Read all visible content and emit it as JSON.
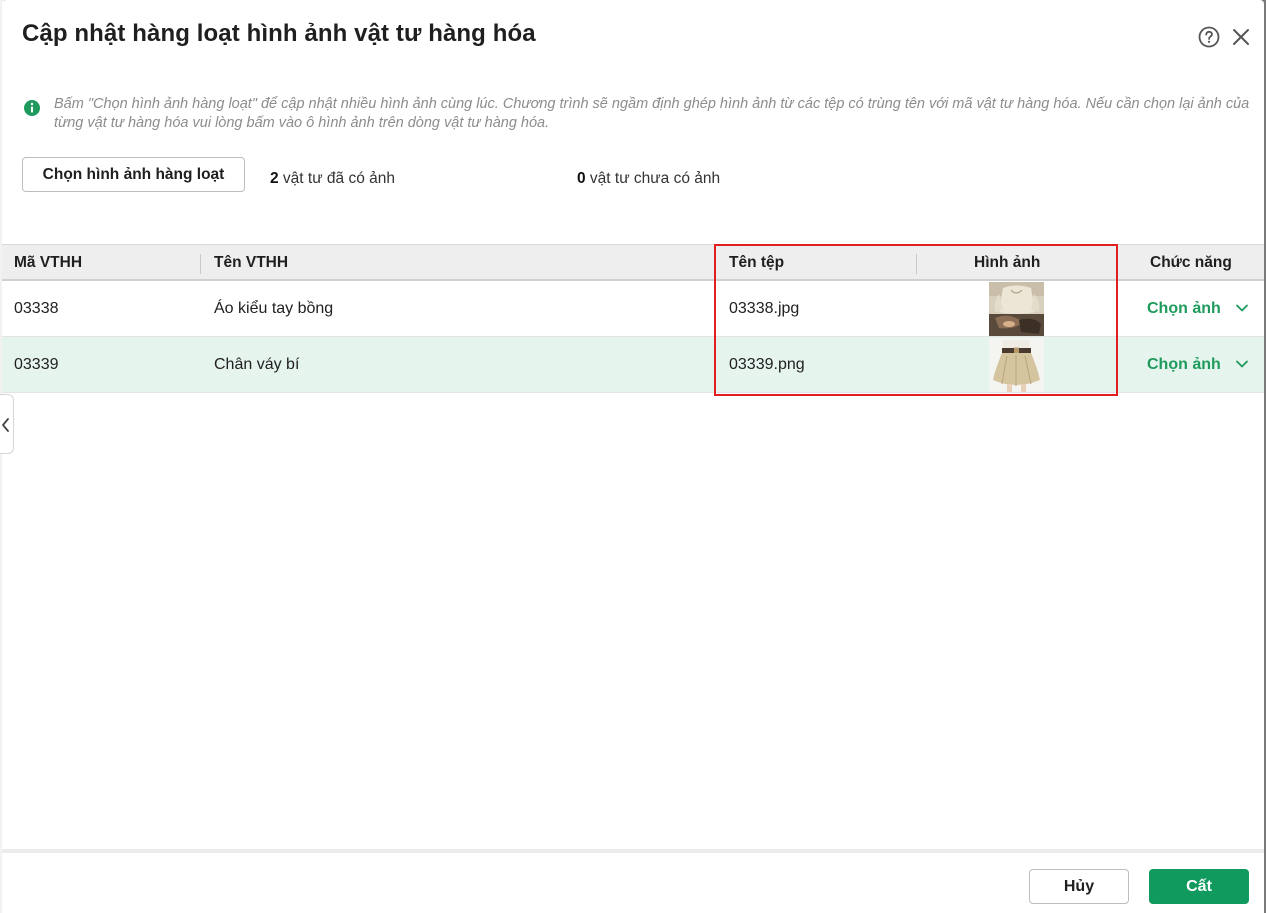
{
  "dialog": {
    "title": "Cập nhật hàng loạt hình ảnh vật tư hàng hóa",
    "help_icon": "help-circle-icon",
    "close_icon": "close-icon"
  },
  "info": {
    "icon": "info-icon",
    "text": "Bấm \"Chọn hình ảnh hàng loạt\" để cập nhật nhiều hình ảnh cùng lúc. Chương trình sẽ ngầm định ghép hình ảnh từ các tệp có trùng tên với mã vật tư hàng hóa. Nếu cần chọn lại ảnh của từng vật tư hàng hóa vui lòng bấm vào ô hình ảnh trên dòng vật tư hàng hóa."
  },
  "toolbar": {
    "bulk_button_label": "Chọn hình ảnh hàng loạt",
    "with_image_count": "2",
    "with_image_text": " vật tư đã có ảnh",
    "without_image_count": "0",
    "without_image_text": " vật tư chưa có ảnh"
  },
  "table": {
    "columns": {
      "code": "Mã VTHH",
      "name": "Tên VTHH",
      "file": "Tên tệp",
      "image": "Hình ảnh",
      "action": "Chức năng"
    },
    "rows": [
      {
        "code": "03338",
        "name": "Áo kiểu tay bồng",
        "file": "03338.jpg",
        "action": "Chọn ảnh"
      },
      {
        "code": "03339",
        "name": "Chân váy bí",
        "file": "03339.png",
        "action": "Chọn ảnh"
      }
    ]
  },
  "footer": {
    "cancel_label": "Hủy",
    "save_label": "Cất"
  },
  "colors": {
    "accent": "#109a5d",
    "action_text": "#1e9b5c",
    "selected_row": "#e6f4ee",
    "highlight_box": "#e02020"
  }
}
